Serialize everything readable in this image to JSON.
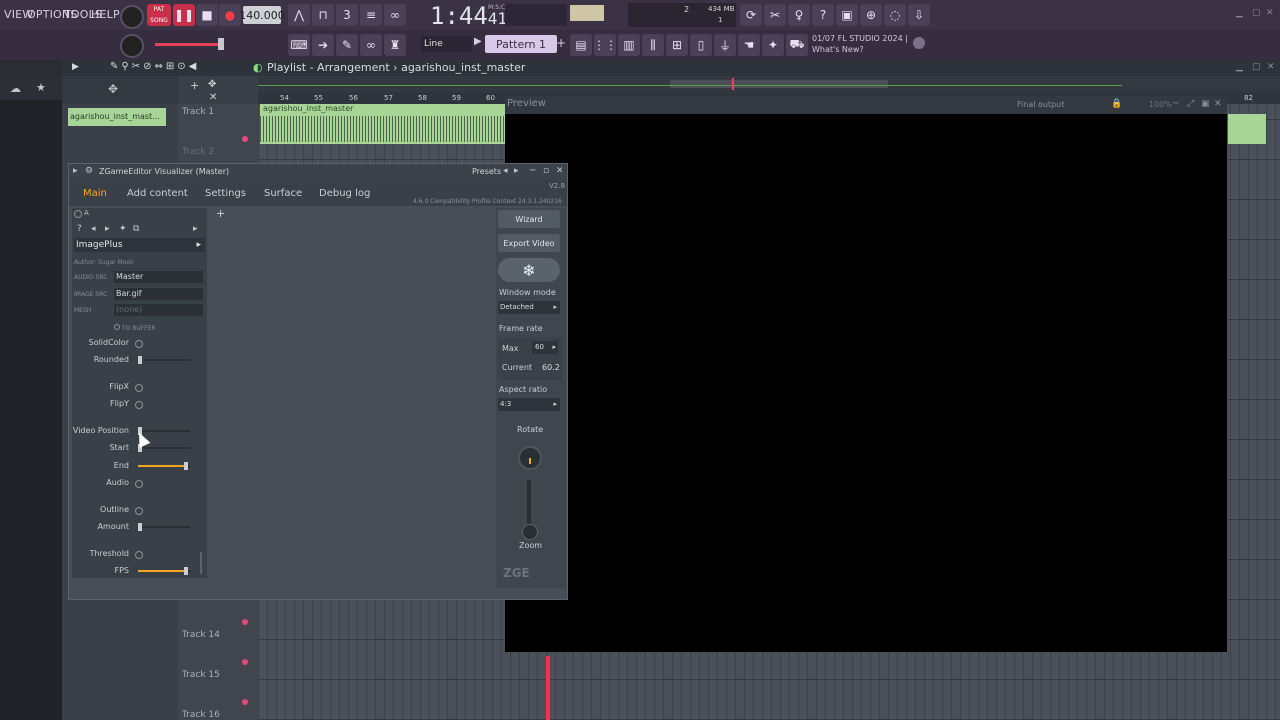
{
  "menu": {
    "view": "VIEW",
    "options": "OPTIONS",
    "tools": "TOOLS",
    "help": "HELP"
  },
  "transport": {
    "song_label": "SONG",
    "pat_label": "PAT",
    "tempo": "140.000",
    "time": "1:44",
    "time_small": "41",
    "msc": "M:S:CS"
  },
  "cpu": {
    "value": "2",
    "memory": "434 MB",
    "voices": "1"
  },
  "toolbar": {
    "snap": "Line",
    "pattern": "Pattern 1"
  },
  "news": {
    "line1": "01/07  FL STUDIO 2024 |",
    "line2": "What's New?"
  },
  "playlist": {
    "title": "Playlist - Arrangement",
    "breadcrumb": "agarishou_inst_master",
    "picker_clip": "agarishou_inst_mast...",
    "clip_label": "agarishou_inst_master",
    "ruler": [
      "54",
      "55",
      "56",
      "57",
      "58",
      "59",
      "60"
    ],
    "ruler_end": "82",
    "tracks": {
      "t1": "Track 1",
      "t2": "Track 2",
      "t14": "Track 14",
      "t15": "Track 15",
      "t16": "Track 16"
    }
  },
  "preview": {
    "title": "Preview",
    "final_output": "Final output",
    "zoom": "100%"
  },
  "zge": {
    "title": "ZGameEditor Visualizer (Master)",
    "presets": "Presets",
    "version": "V2.8",
    "compat": "4.6.0 Compatibility Profile Context 24.3.1.240216",
    "tabs": [
      "Main",
      "Add content",
      "Settings",
      "Surface",
      "Debug log"
    ],
    "layer": "A",
    "effect": "ImagePlus",
    "author": "Author: Sugar Moon",
    "audio_src_label": "AUDIO SRC",
    "audio_src": "Master",
    "image_src_label": "IMAGE SRC",
    "image_src": "Bar.gif",
    "mesh_label": "MESH",
    "mesh": "(none)",
    "to_buffer": "TO BUFFER",
    "params": {
      "solidcolor": "SolidColor",
      "rounded": "Rounded",
      "flipx": "FlipX",
      "flipy": "FlipY",
      "video_position": "Video Position",
      "start": "Start",
      "end": "End",
      "audio": "Audio",
      "outline": "Outline",
      "amount": "Amount",
      "threshold": "Threshold",
      "fps": "FPS"
    },
    "slider_levels": {
      "rounded": 0.0,
      "video_position": 0.0,
      "start": 0.0,
      "end": 0.95,
      "amount": 0.0,
      "fps": 0.95
    },
    "right": {
      "wizard": "Wizard",
      "export_video": "Export Video",
      "window_mode_label": "Window mode",
      "window_mode": "Detached",
      "frame_rate_label": "Frame rate",
      "max_label": "Max",
      "max": "60",
      "current_label": "Current",
      "current": "60.2",
      "aspect_label": "Aspect ratio",
      "aspect": "4:3",
      "rotate": "Rotate",
      "zoom": "Zoom",
      "logo": "ZGE"
    }
  }
}
